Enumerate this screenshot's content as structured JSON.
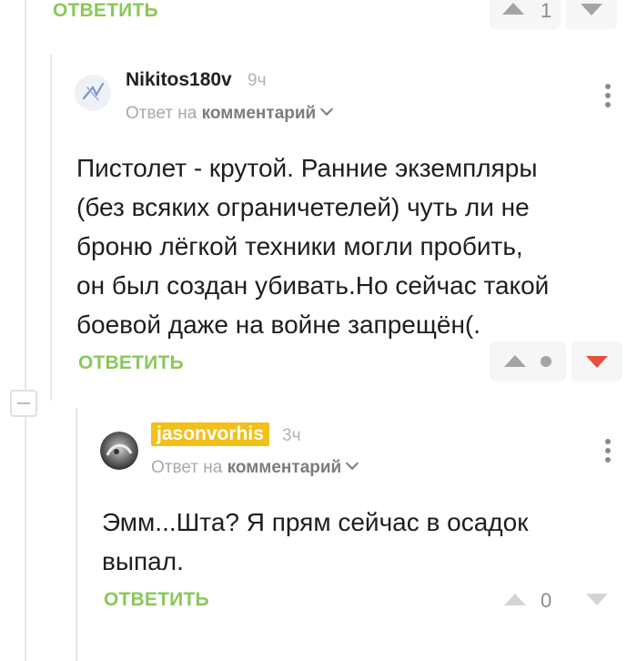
{
  "top_actions": {
    "reply_label": "ОТВЕТИТЬ",
    "score": "1"
  },
  "comment1": {
    "nickname": "Nikitos180v",
    "time": "9ч",
    "reply_to_prefix": "Ответ на",
    "reply_to_target": "комментарий",
    "text_lines": [
      "Пистолет - крутой. Ранние экземпляры",
      "(без всяких ограничетелей) чуть ли не",
      "броню лёгкой техники могли пробить,",
      "он был создан убивать.Но сейчас такой",
      "боевой даже на войне запрещён(."
    ],
    "reply_label": "ОТВЕТИТЬ"
  },
  "comment2": {
    "nickname": "jasonvorhis",
    "time": "3ч",
    "reply_to_prefix": "Ответ на",
    "reply_to_target": "комментарий",
    "text_lines": [
      "Эмм...Шта? Я прям сейчас в осадок",
      "выпал."
    ],
    "reply_label": "ОТВЕТИТЬ",
    "score": "0"
  },
  "colors": {
    "accent_green": "#8ac858",
    "downvote_red": "#e5513b",
    "badge_yellow": "#f2c018"
  },
  "icons": [
    "upvote-icon",
    "downvote-icon",
    "more-icon",
    "chevron-down-icon",
    "collapse-icon"
  ]
}
